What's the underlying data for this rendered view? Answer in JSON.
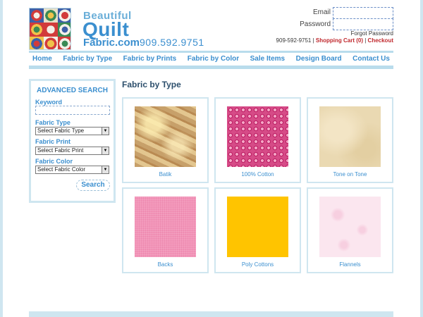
{
  "brand": {
    "line1": "Beautiful",
    "line2": "Quilt",
    "line3": "Fabric.com",
    "phone": "909.592.9751"
  },
  "login": {
    "email_label": "Email",
    "password_label": "Password",
    "forgot_label": "Forgot Password"
  },
  "utility": {
    "phone": "909-592-9751",
    "sep1": " | ",
    "cart": "Shopping Cart (0)",
    "sep2": " | ",
    "checkout": "Checkout"
  },
  "nav": {
    "items": [
      "Home",
      "Fabric by Type",
      "Fabric by Prints",
      "Fabric by Color",
      "Sale Items",
      "Design Board",
      "Contact Us"
    ]
  },
  "sidebar": {
    "title": "ADVANCED SEARCH",
    "keyword_label": "Keyword",
    "type_label": "Fabric Type",
    "type_value": "Select Fabric Type",
    "print_label": "Fabric Print",
    "print_value": "Select Fabric Print",
    "color_label": "Fabric Color",
    "color_value": "Select Fabric Color",
    "search_label": "Search"
  },
  "main": {
    "title": "Fabric by Type",
    "items": [
      {
        "label": "Batik",
        "swatch": "batik"
      },
      {
        "label": "100% Cotton",
        "swatch": "cotton"
      },
      {
        "label": "Tone on Tone",
        "swatch": "tone"
      },
      {
        "label": "Backs",
        "swatch": "backs"
      },
      {
        "label": "Poly Cottons",
        "swatch": "poly"
      },
      {
        "label": "Flannels",
        "swatch": "flannel"
      }
    ]
  },
  "colors": {
    "accent": "#3b8fcf",
    "border": "#cfe6f0",
    "alert": "#c0282d"
  }
}
